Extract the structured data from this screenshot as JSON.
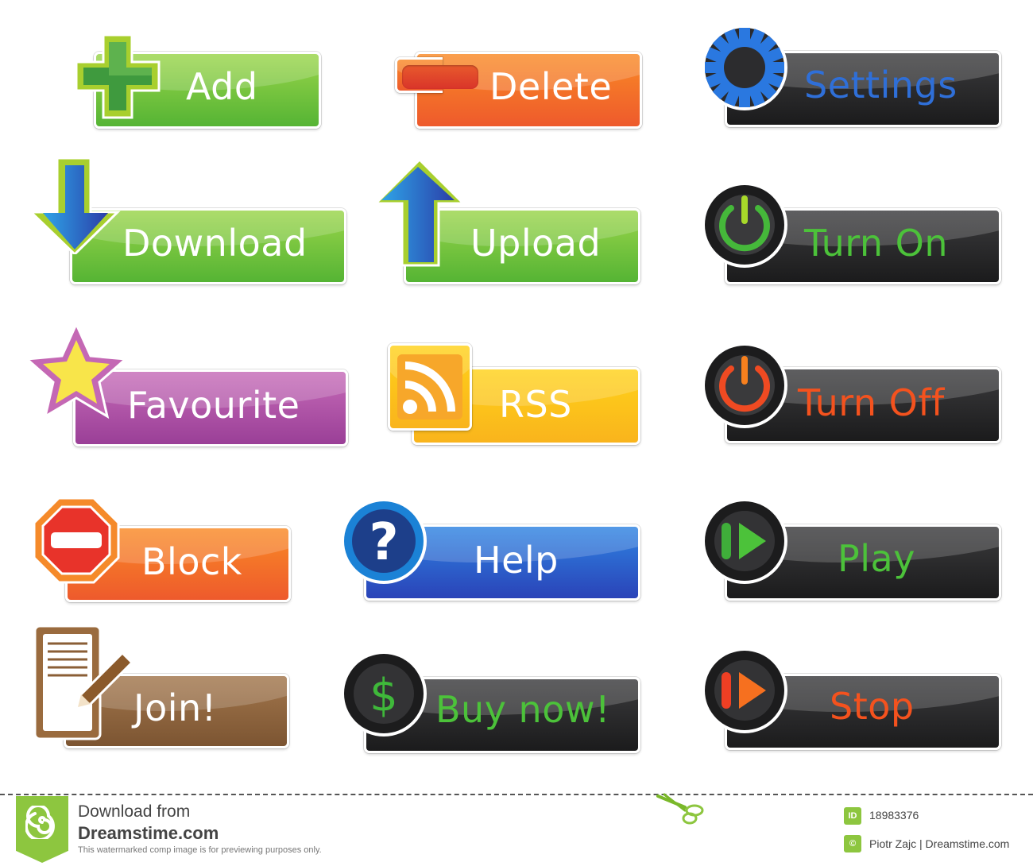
{
  "buttons": [
    {
      "id": "add",
      "label": "Add",
      "icon": "plus-icon",
      "scheme": "green",
      "text_color": "#ffffff"
    },
    {
      "id": "delete",
      "label": "Delete",
      "icon": "minus-icon",
      "scheme": "orange",
      "text_color": "#ffffff"
    },
    {
      "id": "settings",
      "label": "Settings",
      "icon": "gear-icon",
      "scheme": "black",
      "text_color": "#2f6fd8"
    },
    {
      "id": "download",
      "label": "Download",
      "icon": "arrow-down-icon",
      "scheme": "green",
      "text_color": "#ffffff"
    },
    {
      "id": "upload",
      "label": "Upload",
      "icon": "arrow-up-icon",
      "scheme": "green",
      "text_color": "#ffffff"
    },
    {
      "id": "turn-on",
      "label": "Turn On",
      "icon": "power-icon",
      "scheme": "black",
      "text_color": "#4cc23a"
    },
    {
      "id": "favourite",
      "label": "Favourite",
      "icon": "star-icon",
      "scheme": "purple",
      "text_color": "#ffffff"
    },
    {
      "id": "rss",
      "label": "RSS",
      "icon": "rss-icon",
      "scheme": "yellow",
      "text_color": "#ffffff"
    },
    {
      "id": "turn-off",
      "label": "Turn Off",
      "icon": "power-icon",
      "scheme": "black",
      "text_color": "#f4521e"
    },
    {
      "id": "block",
      "label": "Block",
      "icon": "no-entry-icon",
      "scheme": "orange",
      "text_color": "#ffffff"
    },
    {
      "id": "help",
      "label": "Help",
      "icon": "question-icon",
      "scheme": "blue",
      "text_color": "#ffffff"
    },
    {
      "id": "play",
      "label": "Play",
      "icon": "play-icon",
      "scheme": "black",
      "text_color": "#4cc23a"
    },
    {
      "id": "join",
      "label": "Join!",
      "icon": "document-pen-icon",
      "scheme": "brown",
      "text_color": "#ffffff"
    },
    {
      "id": "buy-now",
      "label": "Buy now!",
      "icon": "dollar-icon",
      "scheme": "black",
      "text_color": "#4cc23a"
    },
    {
      "id": "stop",
      "label": "Stop",
      "icon": "play-icon",
      "scheme": "black",
      "text_color": "#f4521e"
    }
  ],
  "icons": {
    "question": "?",
    "dollar": "$"
  },
  "footer": {
    "download_from": "Download from",
    "site": "Dreamstime.com",
    "notice": "This watermarked comp image is for previewing purposes only.",
    "id_badge": "ID",
    "image_id": "18983376",
    "copyright_badge": "©",
    "credit": "Piotr Zajc | Dreamstime.com"
  }
}
